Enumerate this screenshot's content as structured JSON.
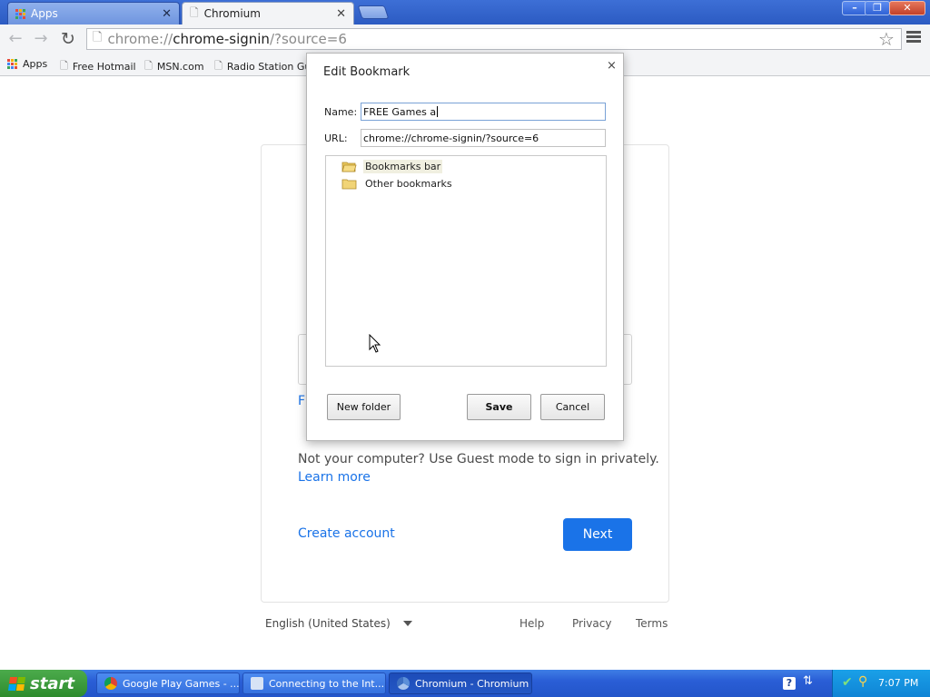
{
  "browser": {
    "tabs": [
      {
        "label": "Apps",
        "active": false
      },
      {
        "label": "Chromium",
        "active": true
      }
    ],
    "window_controls": {
      "minimize": "–",
      "maximize": "❐",
      "close": "✕"
    },
    "url": {
      "scheme": "chrome://",
      "host": "chrome-signin",
      "rest": "/?source=6"
    },
    "bookmarks": [
      {
        "label": "Apps"
      },
      {
        "label": "Free Hotmail"
      },
      {
        "label": "MSN.com"
      },
      {
        "label": "Radio Station Gui"
      }
    ]
  },
  "page": {
    "partial_link": "F",
    "guest_text": "Not your computer? Use Guest mode to sign in privately.",
    "learn_more": "Learn more",
    "create_account": "Create account",
    "next": "Next",
    "language": "English (United States)",
    "footer": {
      "help": "Help",
      "privacy": "Privacy",
      "terms": "Terms"
    }
  },
  "dialog": {
    "title": "Edit Bookmark",
    "close": "×",
    "name_label": "Name:",
    "name_value": "FREE Games a",
    "url_label": "URL:",
    "url_value": "chrome://chrome-signin/?source=6",
    "folders": [
      {
        "label": "Bookmarks bar",
        "selected": true
      },
      {
        "label": "Other bookmarks",
        "selected": false
      }
    ],
    "buttons": {
      "new_folder": "New folder",
      "save": "Save",
      "cancel": "Cancel"
    }
  },
  "taskbar": {
    "start": "start",
    "tasks": [
      {
        "label": "Google Play Games - ...",
        "icon": "chrome-icon"
      },
      {
        "label": "Connecting to the Int...",
        "icon": "network-wizard-icon"
      },
      {
        "label": "Chromium - Chromium",
        "icon": "chromium-icon"
      }
    ],
    "clock": "7:07 PM"
  },
  "colors": {
    "accent_blue": "#1a73e8",
    "xp_taskbar": "#2a5ed6",
    "xp_start_green": "#3a9a3a"
  }
}
